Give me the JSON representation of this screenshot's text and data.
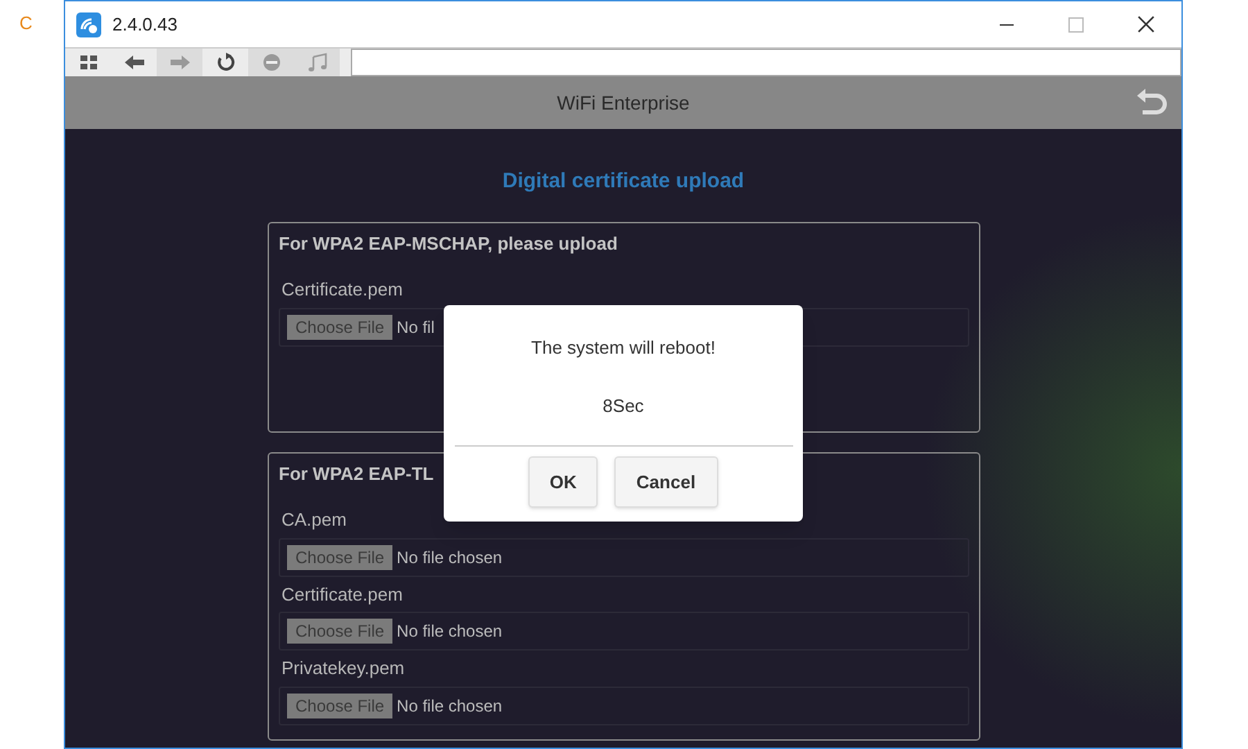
{
  "figure_label": "C",
  "window": {
    "title": "2.4.0.43"
  },
  "toolbar": {
    "buttons": [
      {
        "kind": "apps",
        "disabled": false
      },
      {
        "kind": "back",
        "disabled": false
      },
      {
        "kind": "forward",
        "disabled": true
      },
      {
        "kind": "refresh",
        "disabled": false
      },
      {
        "kind": "stop",
        "disabled": true
      },
      {
        "kind": "music",
        "disabled": true
      }
    ]
  },
  "header": {
    "title": "WiFi Enterprise"
  },
  "page_title": "Digital certificate upload",
  "sections": [
    {
      "title": "For WPA2 EAP-MSCHAP, please upload",
      "files": [
        {
          "label": "Certificate.pem",
          "button": "Choose File",
          "status": "No fil"
        }
      ]
    },
    {
      "title": "For WPA2 EAP-TL",
      "files": [
        {
          "label": "CA.pem",
          "button": "Choose File",
          "status": "No file chosen"
        },
        {
          "label": "Certificate.pem",
          "button": "Choose File",
          "status": "No file chosen"
        },
        {
          "label": "Privatekey.pem",
          "button": "Choose File",
          "status": "No file chosen"
        }
      ]
    }
  ],
  "dialog": {
    "message": "The system will reboot!",
    "countdown": "8Sec",
    "buttons": [
      "OK",
      "Cancel"
    ]
  }
}
